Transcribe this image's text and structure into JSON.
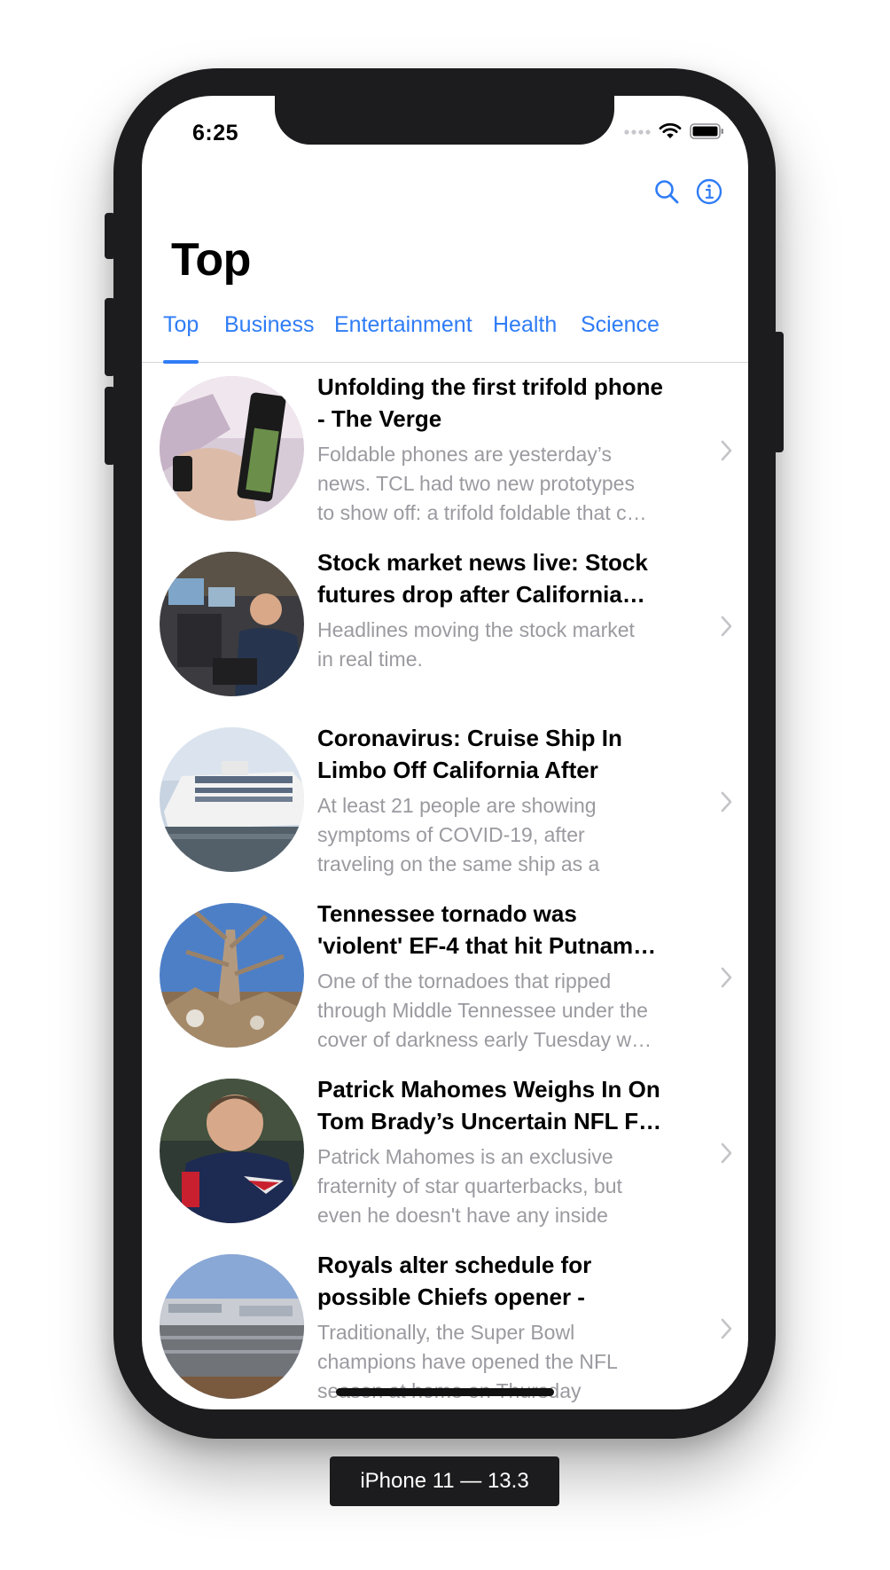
{
  "status_bar": {
    "time": "6:25",
    "signal_icon": "signal-dots-icon",
    "wifi_icon": "wifi-icon",
    "battery_icon": "battery-icon"
  },
  "nav_bar": {
    "title": "Top",
    "search_icon": "search-icon",
    "info_icon": "info-icon",
    "accent_color": "#2f7cf6"
  },
  "tabs": [
    {
      "label": "Top",
      "selected": true
    },
    {
      "label": "Business",
      "selected": false
    },
    {
      "label": "Entertainment",
      "selected": false
    },
    {
      "label": "Health",
      "selected": false
    },
    {
      "label": "Science",
      "selected": false
    }
  ],
  "articles": [
    {
      "headline": "Unfolding the first trifold phone - The Verge",
      "summary": "Foldable phones are yesterday’s news. TCL had two new prototypes to show off: a trifold foldable that c…"
    },
    {
      "headline": "Stock market news live: Stock futures drop after California…",
      "summary": "Headlines moving the stock market in real time."
    },
    {
      "headline": "Coronavirus: Cruise Ship In Limbo Off California After For…",
      "summary": "At least 21 people are showing symptoms of COVID-19, after traveling on the same ship as a pas…"
    },
    {
      "headline": "Tennessee tornado was 'violent' EF-4 that hit Putnam…",
      "summary": "One of the tornadoes that ripped through Middle Tennessee under the cover of darkness early Tuesday w…"
    },
    {
      "headline": "Patrick Mahomes Weighs In On Tom Brady’s Uncertain NFL F…",
      "summary": "Patrick Mahomes is an exclusive fraternity of star quarterbacks, but even he doesn't have any inside sc…"
    },
    {
      "headline": "Royals alter schedule for possible Chiefs opener - NFL.…",
      "summary": "Traditionally, the Super Bowl champions have opened the NFL season at home on Thursday night.…"
    }
  ],
  "device_label": "iPhone 11 — 13.3"
}
